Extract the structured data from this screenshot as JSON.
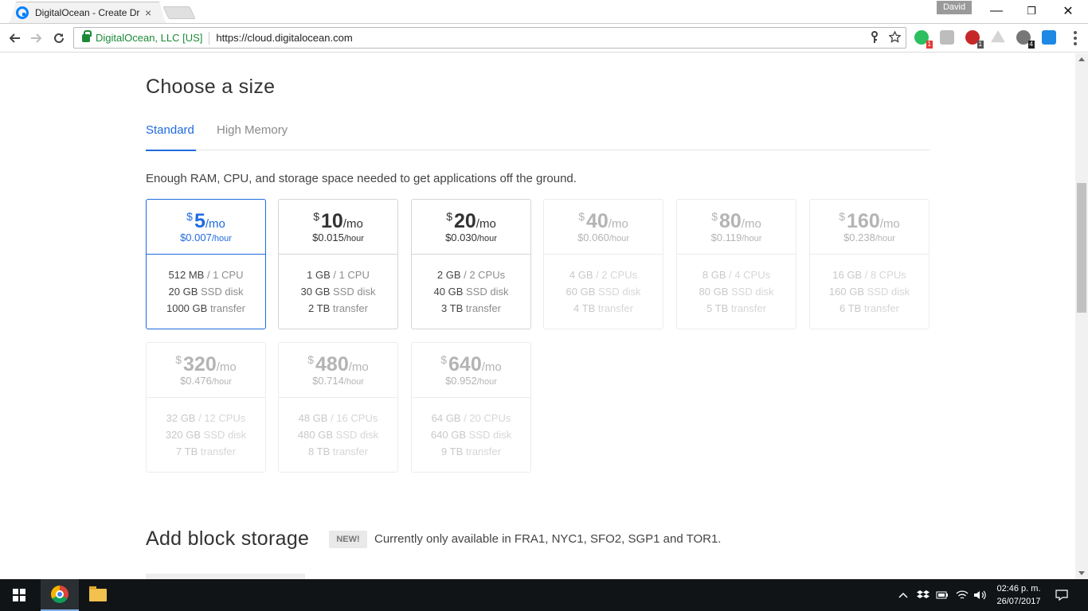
{
  "browser": {
    "tab_title": "DigitalOcean - Create Dr",
    "tab_close": "×",
    "profile_name": "David",
    "minimize": "—",
    "maximize": "❐",
    "close": "✕",
    "secure_label": "DigitalOcean, LLC [US]",
    "url": "https://cloud.digitalocean.com",
    "extensions": [
      {
        "name": "evernote",
        "color": "#2dbe60",
        "badge": "1",
        "badge_color": "#e53935"
      },
      {
        "name": "camera",
        "color": "#bdbdbd",
        "badge": "",
        "badge_color": ""
      },
      {
        "name": "adblock",
        "color": "#c62828",
        "badge": "1",
        "badge_color": "#555555"
      },
      {
        "name": "drive",
        "color": "#cfcfcf",
        "badge": "",
        "badge_color": ""
      },
      {
        "name": "extension-eye",
        "color": "#777777",
        "badge": "4",
        "badge_color": "#222222"
      },
      {
        "name": "s-extension",
        "color": "#1e88e5",
        "badge": "",
        "badge_color": ""
      }
    ]
  },
  "page": {
    "title": "Choose a size",
    "tabs": [
      "Standard",
      "High Memory"
    ],
    "active_tab": "Standard",
    "description": "Enough RAM, CPU, and storage space needed to get applications off the ground.",
    "currency": "$",
    "per_month": "/mo",
    "per_hour": "/hour",
    "plans": [
      {
        "price": "5",
        "hourly": "$0.007",
        "ram": "512 MB",
        "cpu": "1 CPU",
        "disk": "20 GB",
        "transfer": "1000 GB",
        "state": "selected"
      },
      {
        "price": "10",
        "hourly": "$0.015",
        "ram": "1 GB",
        "cpu": "1 CPU",
        "disk": "30 GB",
        "transfer": "2 TB",
        "state": "normal"
      },
      {
        "price": "20",
        "hourly": "$0.030",
        "ram": "2 GB",
        "cpu": "2 CPUs",
        "disk": "40 GB",
        "transfer": "3 TB",
        "state": "normal"
      },
      {
        "price": "40",
        "hourly": "$0.060",
        "ram": "4 GB",
        "cpu": "2 CPUs",
        "disk": "60 GB",
        "transfer": "4 TB",
        "state": "disabled"
      },
      {
        "price": "80",
        "hourly": "$0.119",
        "ram": "8 GB",
        "cpu": "4 CPUs",
        "disk": "80 GB",
        "transfer": "5 TB",
        "state": "disabled"
      },
      {
        "price": "160",
        "hourly": "$0.238",
        "ram": "16 GB",
        "cpu": "8 CPUs",
        "disk": "160 GB",
        "transfer": "6 TB",
        "state": "disabled"
      },
      {
        "price": "320",
        "hourly": "$0.476",
        "ram": "32 GB",
        "cpu": "12 CPUs",
        "disk": "320 GB",
        "transfer": "7 TB",
        "state": "disabled"
      },
      {
        "price": "480",
        "hourly": "$0.714",
        "ram": "48 GB",
        "cpu": "16 CPUs",
        "disk": "480 GB",
        "transfer": "8 TB",
        "state": "disabled"
      },
      {
        "price": "640",
        "hourly": "$0.952",
        "ram": "64 GB",
        "cpu": "20 CPUs",
        "disk": "640 GB",
        "transfer": "9 TB",
        "state": "disabled"
      }
    ],
    "spec_suffix_disk": "SSD disk",
    "spec_suffix_transfer": "transfer",
    "block_storage_title": "Add block storage",
    "new_badge": "NEW!",
    "block_storage_note": "Currently only available in FRA1, NYC1, SFO2, SGP1 and TOR1."
  },
  "taskbar": {
    "time": "02:46 p. m.",
    "date": "26/07/2017"
  }
}
